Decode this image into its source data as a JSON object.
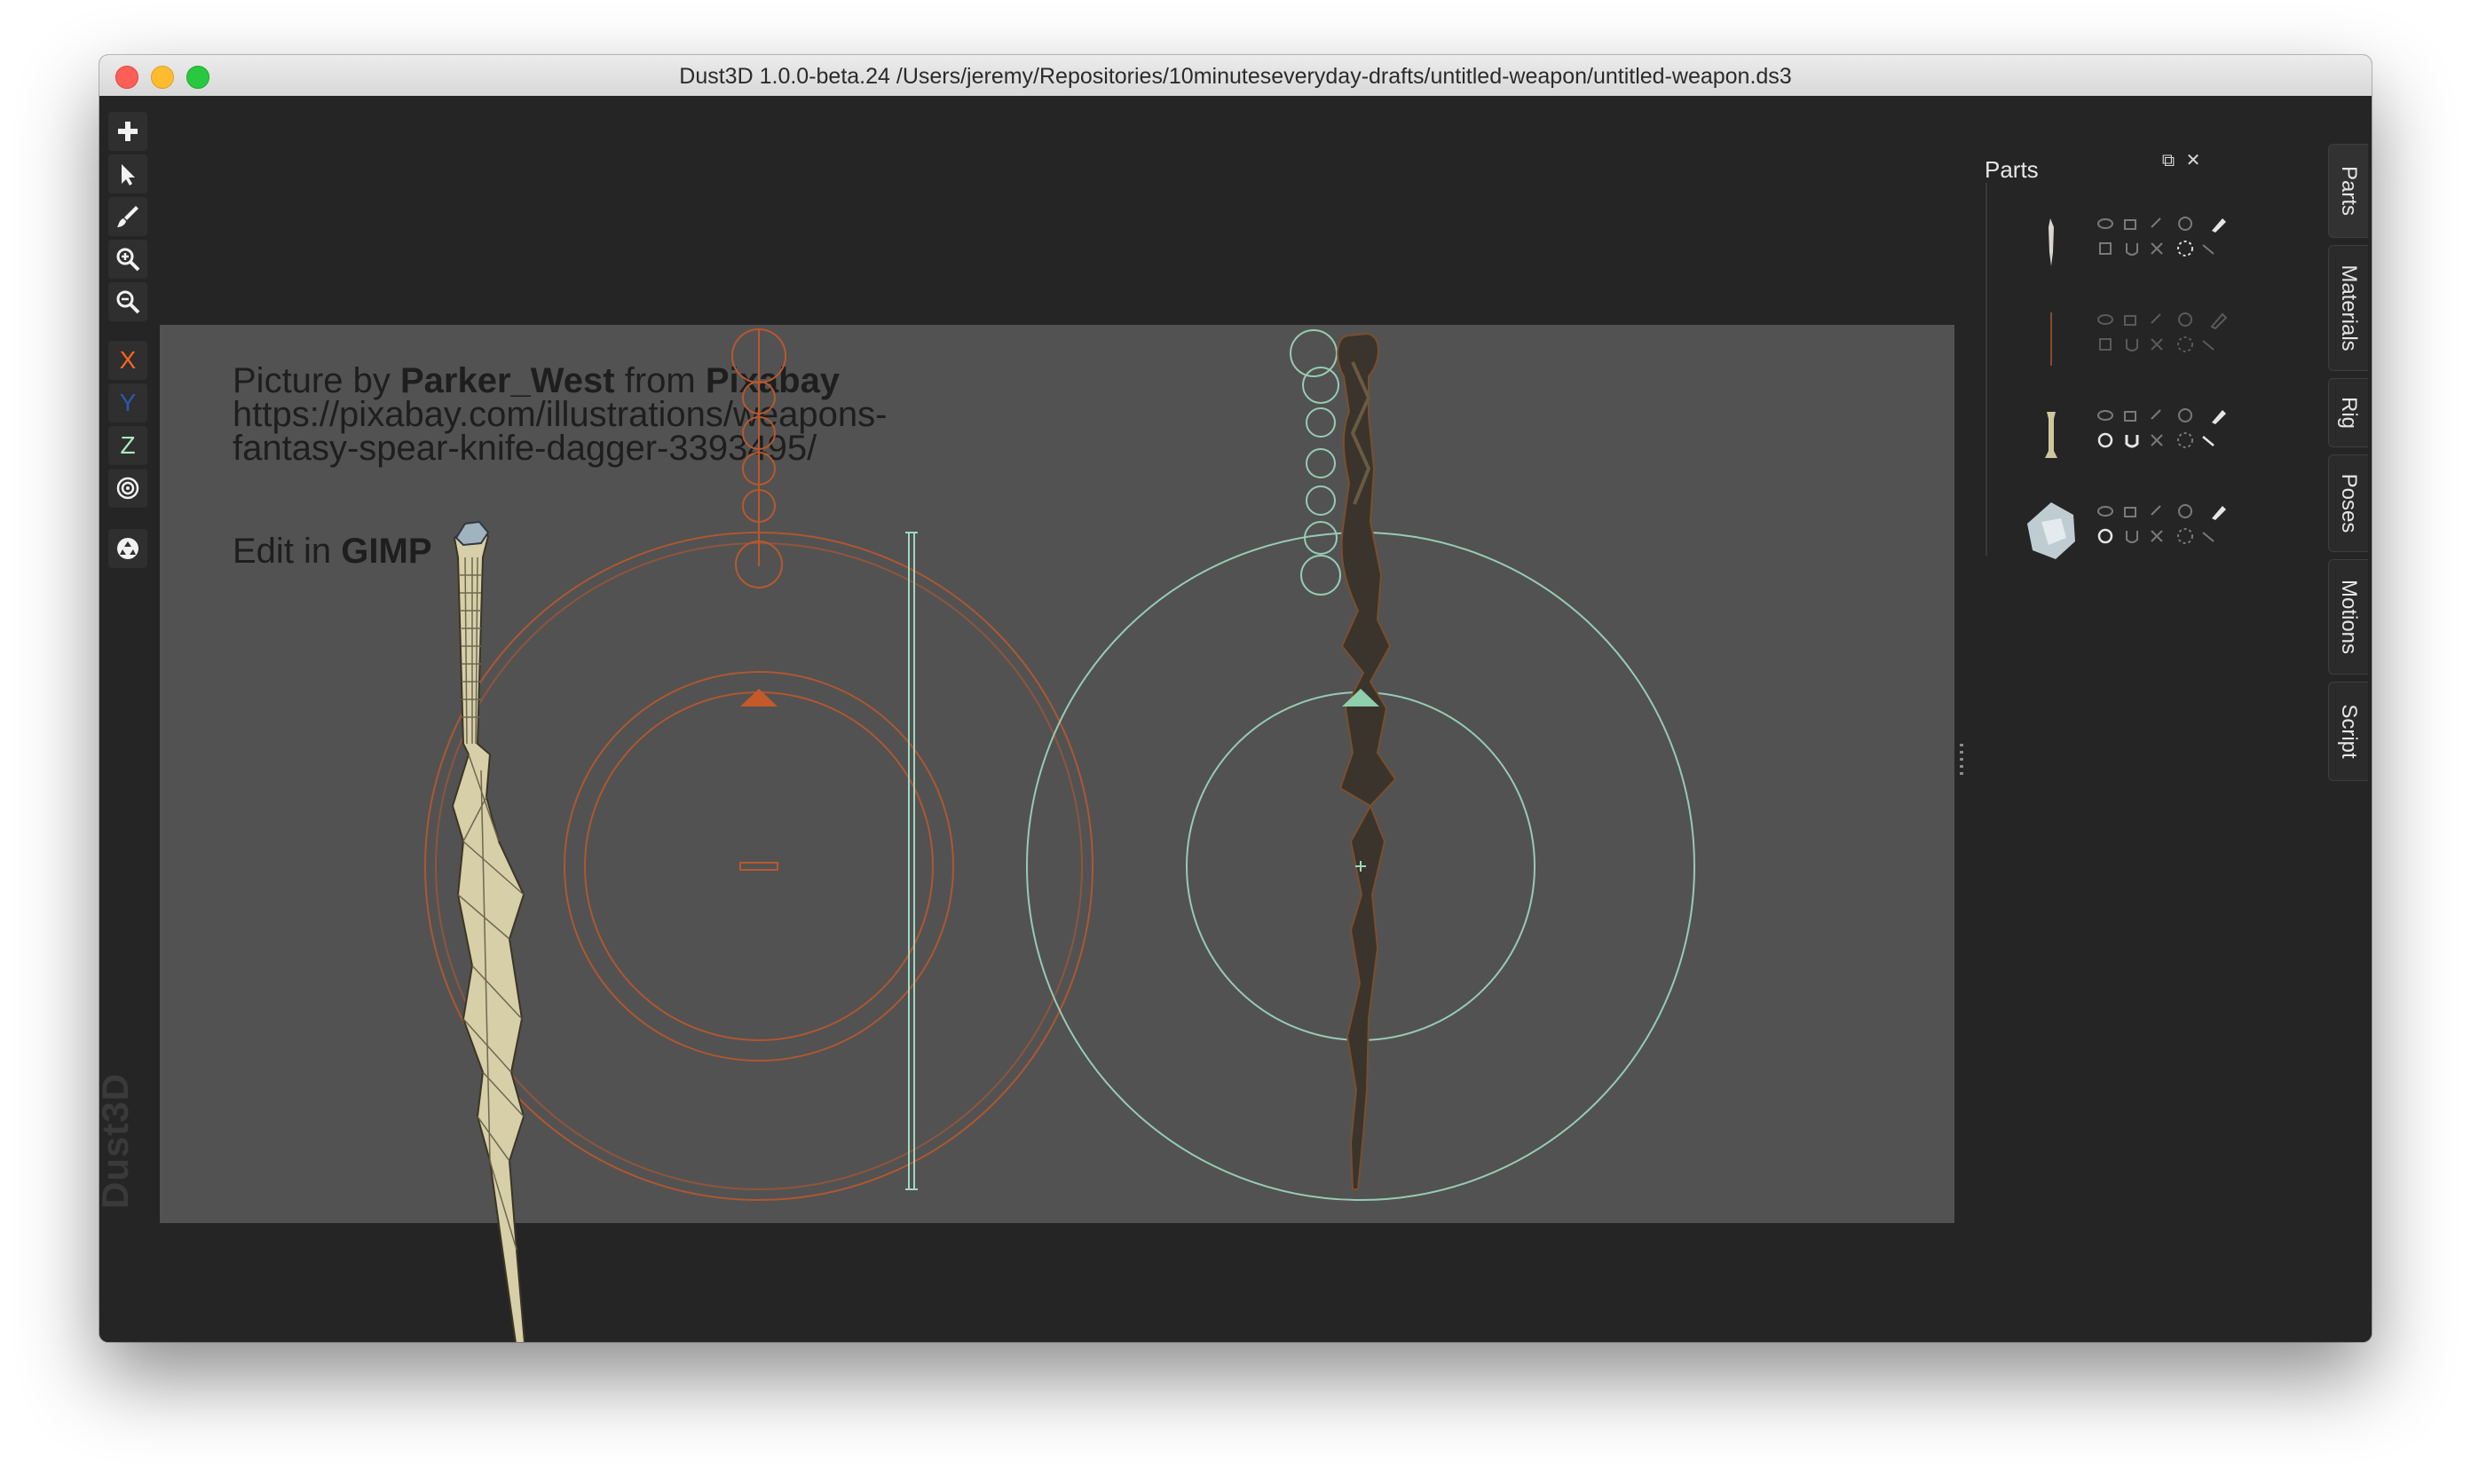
{
  "window": {
    "title": "Dust3D 1.0.0-beta.24 /Users/jeremy/Repositories/10minuteseveryday-drafts/untitled-weapon/untitled-weapon.ds3"
  },
  "toolbar": {
    "tools": [
      {
        "name": "add-icon"
      },
      {
        "name": "select-pointer-icon"
      },
      {
        "name": "paint-brush-icon"
      },
      {
        "name": "zoom-in-icon"
      },
      {
        "name": "zoom-out-icon"
      }
    ],
    "axes": {
      "x": "X",
      "y": "Y",
      "z": "Z"
    },
    "axis_colors": {
      "x": "#fc6621",
      "y": "#2a5aac",
      "z": "#aaebc4"
    },
    "extra_tools": [
      {
        "name": "radial-center-icon"
      },
      {
        "name": "recycle-icon"
      }
    ]
  },
  "branding": {
    "watermark": "Dust3D"
  },
  "reference_image": {
    "line1_prefix": "Picture by ",
    "line1_author": "Parker_West",
    "line1_mid": " from ",
    "line1_site": "Pixabay",
    "url_line1": "https://pixabay.com/illustrations/weapons-",
    "url_line2": "fantasy-spear-knife-dagger-3393495/",
    "edit_prefix": "Edit in ",
    "edit_app": "GIMP",
    "background": "#525252"
  },
  "parts_panel": {
    "title": "Parts",
    "restore_label": "⧉",
    "close_label": "✕",
    "parts": [
      {
        "name": "blade-part",
        "thumb": "thin-blade"
      },
      {
        "name": "thin-part",
        "thumb": "thin-line"
      },
      {
        "name": "grip-part",
        "thumb": "bone-grip"
      },
      {
        "name": "pommel-part",
        "thumb": "polyhedron"
      }
    ]
  },
  "tabs": {
    "items": [
      "Parts",
      "Materials",
      "Rig",
      "Poses",
      "Motions",
      "Script"
    ]
  },
  "colors": {
    "accent_orange": "#fc6621",
    "accent_teal": "#aaebc4",
    "model_fill": "#d6cfa8"
  }
}
